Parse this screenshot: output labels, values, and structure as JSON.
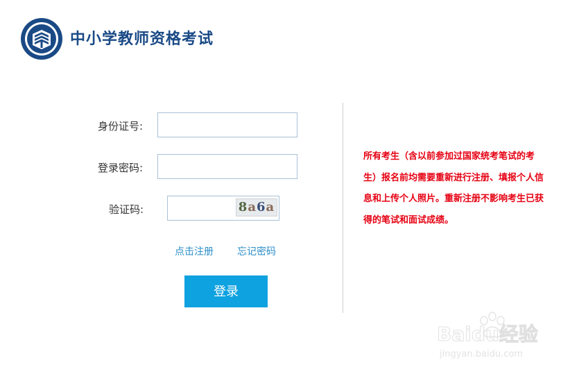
{
  "header": {
    "title": "中小学教师资格考试"
  },
  "form": {
    "id_label": "身份证号:",
    "password_label": "登录密码:",
    "captcha_label": "验证码:",
    "id_value": "",
    "password_value": "",
    "captcha_value": "",
    "captcha_text": [
      "8",
      "a",
      "6",
      "a"
    ]
  },
  "links": {
    "register": "点击注册",
    "forgot_password": "忘记密码"
  },
  "login_button": "登录",
  "notice": "所有考生（含以前参加过国家统考笔试的考生）报名前均需要重新进行注册、填报个人信息和上传个人照片。重新注册不影响考生已获得的笔试和面试成绩。",
  "watermark": {
    "brand": "Baidu经验",
    "url": "jingyan.baidu.com"
  },
  "colors": {
    "title": "#1a4a86",
    "button": "#0fa2e0",
    "link": "#2b8ec9",
    "notice": "#e60012"
  }
}
